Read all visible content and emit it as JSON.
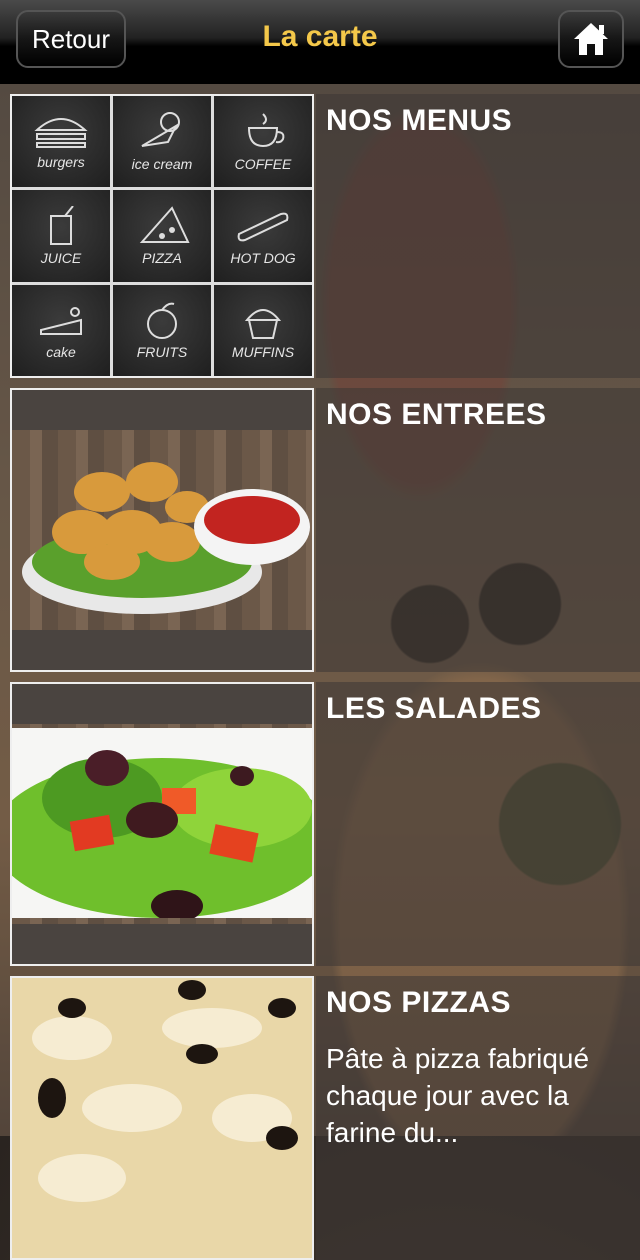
{
  "header": {
    "back_label": "Retour",
    "title": "La carte",
    "home_icon": "home-icon"
  },
  "chalk_tiles": [
    {
      "label": "burgers",
      "icon": "burger-icon"
    },
    {
      "label": "ice cream",
      "icon": "ice-cream-icon"
    },
    {
      "label": "COFFEE",
      "icon": "coffee-icon"
    },
    {
      "label": "JUICE",
      "icon": "juice-icon"
    },
    {
      "label": "PIZZA",
      "icon": "pizza-slice-icon"
    },
    {
      "label": "HOT DOG",
      "icon": "hot-dog-icon"
    },
    {
      "label": "cake",
      "icon": "cake-icon"
    },
    {
      "label": "FRUITS",
      "icon": "apple-icon"
    },
    {
      "label": "MUFFINS",
      "icon": "muffin-icon"
    }
  ],
  "items": [
    {
      "title": "NOS MENUS",
      "description": ""
    },
    {
      "title": "NOS ENTREES",
      "description": ""
    },
    {
      "title": "LES SALADES",
      "description": ""
    },
    {
      "title": "NOS PIZZAS",
      "description": "Pâte à pizza fabriqué chaque jour avec la farine du..."
    }
  ],
  "colors": {
    "title_accent": "#f4c84a"
  }
}
